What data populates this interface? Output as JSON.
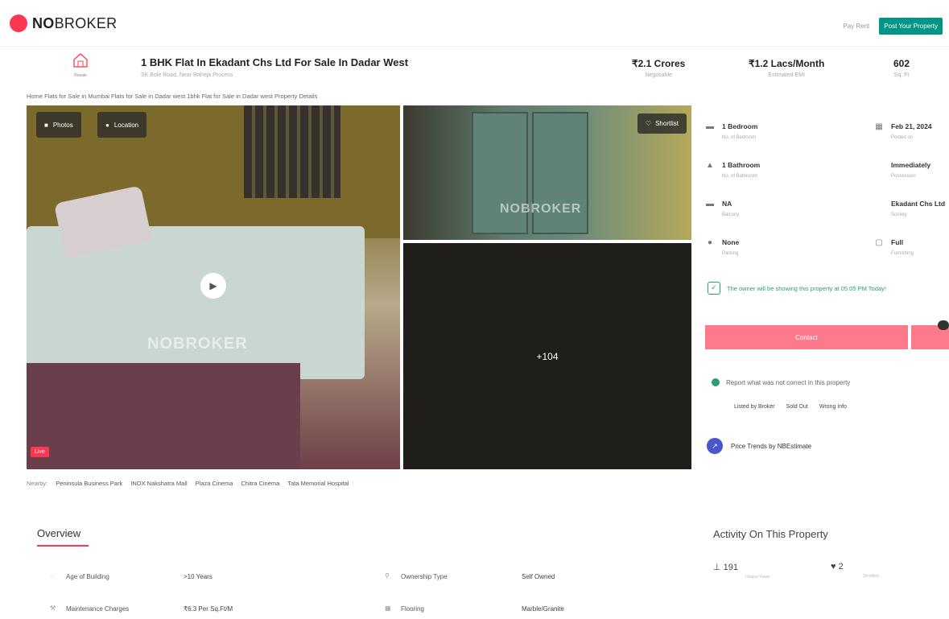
{
  "header": {
    "logo_no": "NO",
    "logo_broker": "BROKER",
    "pay_rent": "Pay Rent",
    "post_property": "Post Your Property"
  },
  "property": {
    "icon_label": "Resale",
    "title": "1 BHK Flat In Ekadant Chs Ltd For Sale In Dadar West",
    "subtitle": "SK Bole Road, Near Raheja Process",
    "price": "₹2.1 Crores",
    "price_sub": "Negotiable",
    "emi": "₹1.2 Lacs/Month",
    "emi_sub": "Estimated EMI",
    "area": "602",
    "area_sub": "Sq. Ft"
  },
  "breadcrumb": "Home  Flats for Sale in Mumbai  Flats for Sale in Dadar west  1bhk Flat for Sale in Dadar west  Property Details",
  "gallery": {
    "photos_label": "Photos",
    "location_label": "Location",
    "shortlist_label": "Shortlist",
    "more_count": "+104",
    "live_tag": "Live",
    "watermark": "NOBROKER"
  },
  "nearby": {
    "label": "Nearby:",
    "places": [
      "Peninsula Business Park",
      "INOX Nakshatra Mall",
      "Plaza Cinema",
      "Chitra Cinema",
      "Tata Memorial Hospital"
    ]
  },
  "info": [
    {
      "icon": "bed-icon",
      "glyph": "▬",
      "value": "1 Bedroom",
      "sub": "No. of Bedroom"
    },
    {
      "icon": "calendar-icon",
      "glyph": "▦",
      "value": "Feb 21, 2024",
      "sub": "Posted on"
    },
    {
      "icon": "bath-icon",
      "glyph": "▲",
      "value": "1 Bathroom",
      "sub": "No. of Bathroom"
    },
    {
      "icon": "possession-icon",
      "glyph": "",
      "value": "Immediately",
      "sub": "Possession"
    },
    {
      "icon": "balcony-icon",
      "glyph": "▬",
      "value": "NA",
      "sub": "Balcony"
    },
    {
      "icon": "society-icon",
      "glyph": "",
      "value": "Ekadant Chs Ltd",
      "sub": "Society"
    },
    {
      "icon": "car-icon",
      "glyph": "●",
      "value": "None",
      "sub": "Parking"
    },
    {
      "icon": "furnish-icon",
      "glyph": "▢",
      "value": "Full",
      "sub": "Furnishing"
    }
  ],
  "showing_text": "The owner will be showing this property at 05:05 PM Today!",
  "contact_label": "Contact",
  "report": {
    "text": "Report what was not correct in this property",
    "links": [
      "Listed by Broker",
      "Sold Out",
      "Wrong Info"
    ]
  },
  "trends_label": "Price Trends by NBEstimate",
  "overview": {
    "title": "Overview",
    "rows": [
      {
        "label": "Age of Building",
        "value": ">10 Years"
      },
      {
        "label": "Ownership Type",
        "value": "Self Owned"
      },
      {
        "label": "Maintenance Charges",
        "value": "₹6.3 Per Sq.Ft/M"
      },
      {
        "label": "Flooring",
        "value": "Marble/Granite"
      }
    ]
  },
  "activity": {
    "title": "Activity On This Property",
    "views": "191",
    "views_sub": "Unique Views",
    "shortlists": "2",
    "shortlists_sub": "Shortlists"
  },
  "colors": {
    "brand": "#fd3752",
    "green": "#009587",
    "contact": "#fd7a8c"
  }
}
